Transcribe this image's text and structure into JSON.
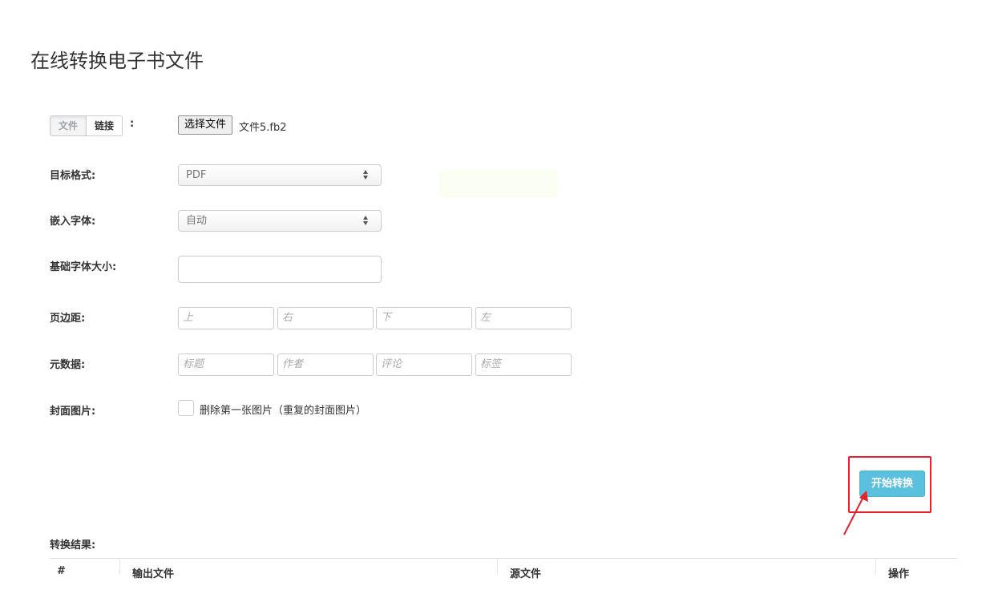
{
  "page": {
    "title": "在线转换电子书文件"
  },
  "source": {
    "tab_file": "文件",
    "tab_link": "链接",
    "colon": ":",
    "choose_file_label": "选择文件",
    "file_name": "文件5.fb2"
  },
  "form": {
    "target_format": {
      "label": "目标格式:",
      "value": "PDF"
    },
    "embed_font": {
      "label": "嵌入字体:",
      "value": "自动"
    },
    "base_font_size": {
      "label": "基础字体大小:",
      "value": ""
    },
    "margins": {
      "label": "页边距:",
      "placeholders": [
        "上",
        "右",
        "下",
        "左"
      ]
    },
    "metadata": {
      "label": "元数据:",
      "placeholders": [
        "标题",
        "作者",
        "评论",
        "标签"
      ]
    },
    "cover": {
      "label": "封面图片:",
      "checkbox_label": "删除第一张图片（重复的封面图片）",
      "checked": false
    }
  },
  "actions": {
    "convert_label": "开始转换"
  },
  "colors": {
    "accent_button": "#5bc0de",
    "annotation_red": "#e62129"
  },
  "results": {
    "label": "转换结果:",
    "columns": [
      "#",
      "输出文件",
      "源文件",
      "操作"
    ]
  }
}
